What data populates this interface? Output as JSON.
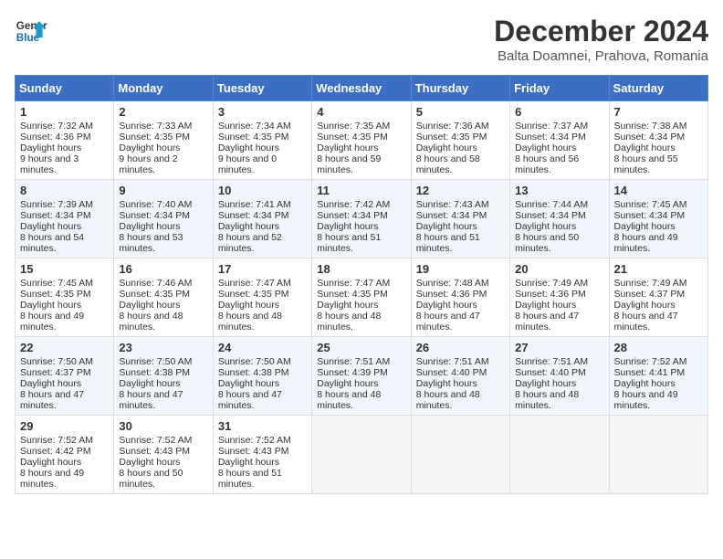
{
  "header": {
    "logo_line1": "General",
    "logo_line2": "Blue",
    "month": "December 2024",
    "location": "Balta Doamnei, Prahova, Romania"
  },
  "weekdays": [
    "Sunday",
    "Monday",
    "Tuesday",
    "Wednesday",
    "Thursday",
    "Friday",
    "Saturday"
  ],
  "weeks": [
    [
      {
        "day": 1,
        "rise": "7:32 AM",
        "set": "4:36 PM",
        "daylight": "9 hours and 3 minutes."
      },
      {
        "day": 2,
        "rise": "7:33 AM",
        "set": "4:35 PM",
        "daylight": "9 hours and 2 minutes."
      },
      {
        "day": 3,
        "rise": "7:34 AM",
        "set": "4:35 PM",
        "daylight": "9 hours and 0 minutes."
      },
      {
        "day": 4,
        "rise": "7:35 AM",
        "set": "4:35 PM",
        "daylight": "8 hours and 59 minutes."
      },
      {
        "day": 5,
        "rise": "7:36 AM",
        "set": "4:35 PM",
        "daylight": "8 hours and 58 minutes."
      },
      {
        "day": 6,
        "rise": "7:37 AM",
        "set": "4:34 PM",
        "daylight": "8 hours and 56 minutes."
      },
      {
        "day": 7,
        "rise": "7:38 AM",
        "set": "4:34 PM",
        "daylight": "8 hours and 55 minutes."
      }
    ],
    [
      {
        "day": 8,
        "rise": "7:39 AM",
        "set": "4:34 PM",
        "daylight": "8 hours and 54 minutes."
      },
      {
        "day": 9,
        "rise": "7:40 AM",
        "set": "4:34 PM",
        "daylight": "8 hours and 53 minutes."
      },
      {
        "day": 10,
        "rise": "7:41 AM",
        "set": "4:34 PM",
        "daylight": "8 hours and 52 minutes."
      },
      {
        "day": 11,
        "rise": "7:42 AM",
        "set": "4:34 PM",
        "daylight": "8 hours and 51 minutes."
      },
      {
        "day": 12,
        "rise": "7:43 AM",
        "set": "4:34 PM",
        "daylight": "8 hours and 51 minutes."
      },
      {
        "day": 13,
        "rise": "7:44 AM",
        "set": "4:34 PM",
        "daylight": "8 hours and 50 minutes."
      },
      {
        "day": 14,
        "rise": "7:45 AM",
        "set": "4:34 PM",
        "daylight": "8 hours and 49 minutes."
      }
    ],
    [
      {
        "day": 15,
        "rise": "7:45 AM",
        "set": "4:35 PM",
        "daylight": "8 hours and 49 minutes."
      },
      {
        "day": 16,
        "rise": "7:46 AM",
        "set": "4:35 PM",
        "daylight": "8 hours and 48 minutes."
      },
      {
        "day": 17,
        "rise": "7:47 AM",
        "set": "4:35 PM",
        "daylight": "8 hours and 48 minutes."
      },
      {
        "day": 18,
        "rise": "7:47 AM",
        "set": "4:35 PM",
        "daylight": "8 hours and 48 minutes."
      },
      {
        "day": 19,
        "rise": "7:48 AM",
        "set": "4:36 PM",
        "daylight": "8 hours and 47 minutes."
      },
      {
        "day": 20,
        "rise": "7:49 AM",
        "set": "4:36 PM",
        "daylight": "8 hours and 47 minutes."
      },
      {
        "day": 21,
        "rise": "7:49 AM",
        "set": "4:37 PM",
        "daylight": "8 hours and 47 minutes."
      }
    ],
    [
      {
        "day": 22,
        "rise": "7:50 AM",
        "set": "4:37 PM",
        "daylight": "8 hours and 47 minutes."
      },
      {
        "day": 23,
        "rise": "7:50 AM",
        "set": "4:38 PM",
        "daylight": "8 hours and 47 minutes."
      },
      {
        "day": 24,
        "rise": "7:50 AM",
        "set": "4:38 PM",
        "daylight": "8 hours and 47 minutes."
      },
      {
        "day": 25,
        "rise": "7:51 AM",
        "set": "4:39 PM",
        "daylight": "8 hours and 48 minutes."
      },
      {
        "day": 26,
        "rise": "7:51 AM",
        "set": "4:40 PM",
        "daylight": "8 hours and 48 minutes."
      },
      {
        "day": 27,
        "rise": "7:51 AM",
        "set": "4:40 PM",
        "daylight": "8 hours and 48 minutes."
      },
      {
        "day": 28,
        "rise": "7:52 AM",
        "set": "4:41 PM",
        "daylight": "8 hours and 49 minutes."
      }
    ],
    [
      {
        "day": 29,
        "rise": "7:52 AM",
        "set": "4:42 PM",
        "daylight": "8 hours and 49 minutes."
      },
      {
        "day": 30,
        "rise": "7:52 AM",
        "set": "4:43 PM",
        "daylight": "8 hours and 50 minutes."
      },
      {
        "day": 31,
        "rise": "7:52 AM",
        "set": "4:43 PM",
        "daylight": "8 hours and 51 minutes."
      },
      null,
      null,
      null,
      null
    ]
  ]
}
